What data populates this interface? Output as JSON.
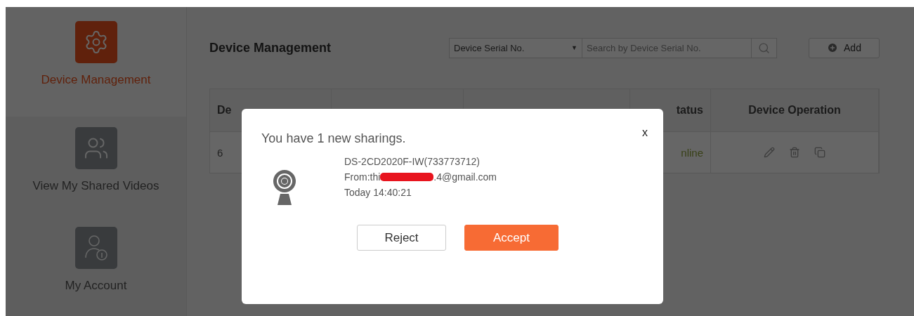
{
  "sidebar": {
    "items": [
      {
        "label": "Device Management",
        "kind": "gear",
        "selected": true
      },
      {
        "label": "View My Shared Videos",
        "kind": "users",
        "selected": false
      },
      {
        "label": "My Account",
        "kind": "account",
        "selected": false
      }
    ]
  },
  "main": {
    "title": "Device Management",
    "search": {
      "filter": "Device Serial No.",
      "caret": "▼",
      "placeholder": "Search by Device Serial No."
    },
    "add_button": "Add",
    "table": {
      "columns": [
        {
          "label": "De"
        },
        {},
        {},
        {
          "label": "tatus"
        },
        {
          "label": "Device Operation"
        }
      ],
      "rows": [
        {
          "cells": [
            {
              "text": "6"
            },
            {},
            {},
            {
              "text": "nline",
              "kind": "status"
            },
            {
              "kind": "operations"
            }
          ]
        }
      ]
    }
  },
  "dialog": {
    "title": "You have 1 new sharings.",
    "close": "x",
    "device": "DS-2CD2020F-IW(733773712)",
    "from_start": "From:thi",
    "from_end": ".4@gmail.com",
    "redacted": true,
    "time": "Today 14:40:21",
    "buttons": [
      {
        "label": "Reject",
        "kind": "secondary"
      },
      {
        "label": "Accept",
        "kind": "primary"
      }
    ]
  }
}
